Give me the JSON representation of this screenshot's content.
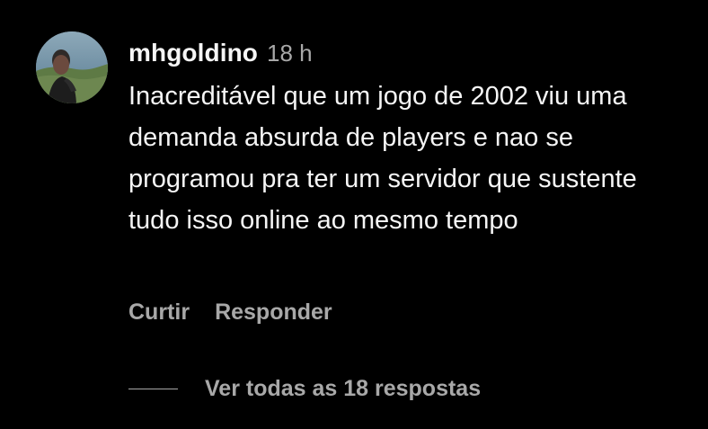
{
  "comment": {
    "avatar_icon": "user-avatar-photo",
    "username": "mhgoldino",
    "timestamp": "18 h",
    "text": "Inacreditável que um jogo de 2002 viu uma demanda absurda de players e nao se programou pra ter um servidor que sustente tudo isso online ao mesmo tempo"
  },
  "actions": {
    "like_label": "Curtir",
    "reply_label": "Responder"
  },
  "replies": {
    "view_all_label": "Ver todas as 18 respostas"
  },
  "colors": {
    "background": "#000000",
    "primary_text": "#f5f5f5",
    "secondary_text": "#a8a8a8"
  }
}
